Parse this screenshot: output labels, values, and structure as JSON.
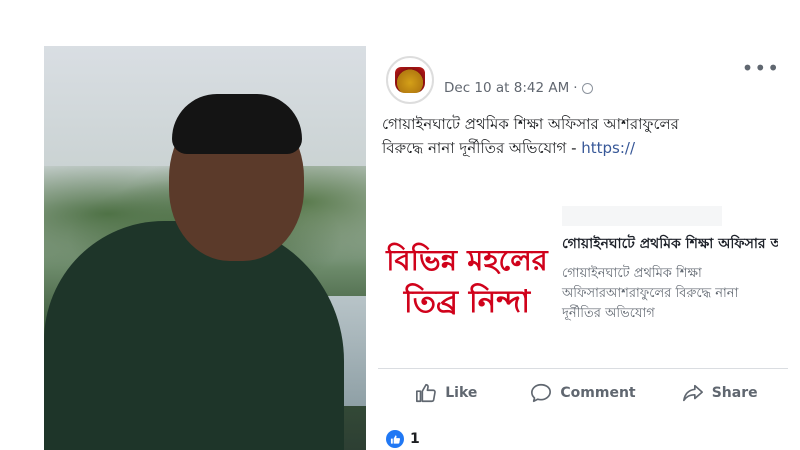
{
  "post": {
    "timestamp": "Dec 10 at 8:42 AM",
    "separator": "·",
    "more_icon_glyph": "•••",
    "text_main": "গোয়াইনঘাটে প্রথমিক শিক্ষা অফিসার আশরাফুলের বিরুদ্ধে নানা দূর্নীতির অভিযোগ - ",
    "text_link": "https://",
    "avatar_icon": "crown-logo-icon"
  },
  "preview": {
    "image_line1": "বিভিন্ন মহলের",
    "image_line2": "তিব্র নিন্দা",
    "title": "গোয়াইনঘাটে প্রথমিক শিক্ষা অফিসার আশরাফুলের বিরু...",
    "description": "গোয়াইনঘাটে প্রথমিক শিক্ষা অফিসারআশরাফুলের বিরুদ্ধে নানা দূর্নীতির অভিযোগ"
  },
  "actions": {
    "like_label": "Like",
    "comment_label": "Comment",
    "share_label": "Share"
  },
  "reactions": {
    "count": "1"
  },
  "colors": {
    "link": "#385898",
    "like_badge": "#2078f4",
    "preview_image_text": "#d0021b"
  }
}
